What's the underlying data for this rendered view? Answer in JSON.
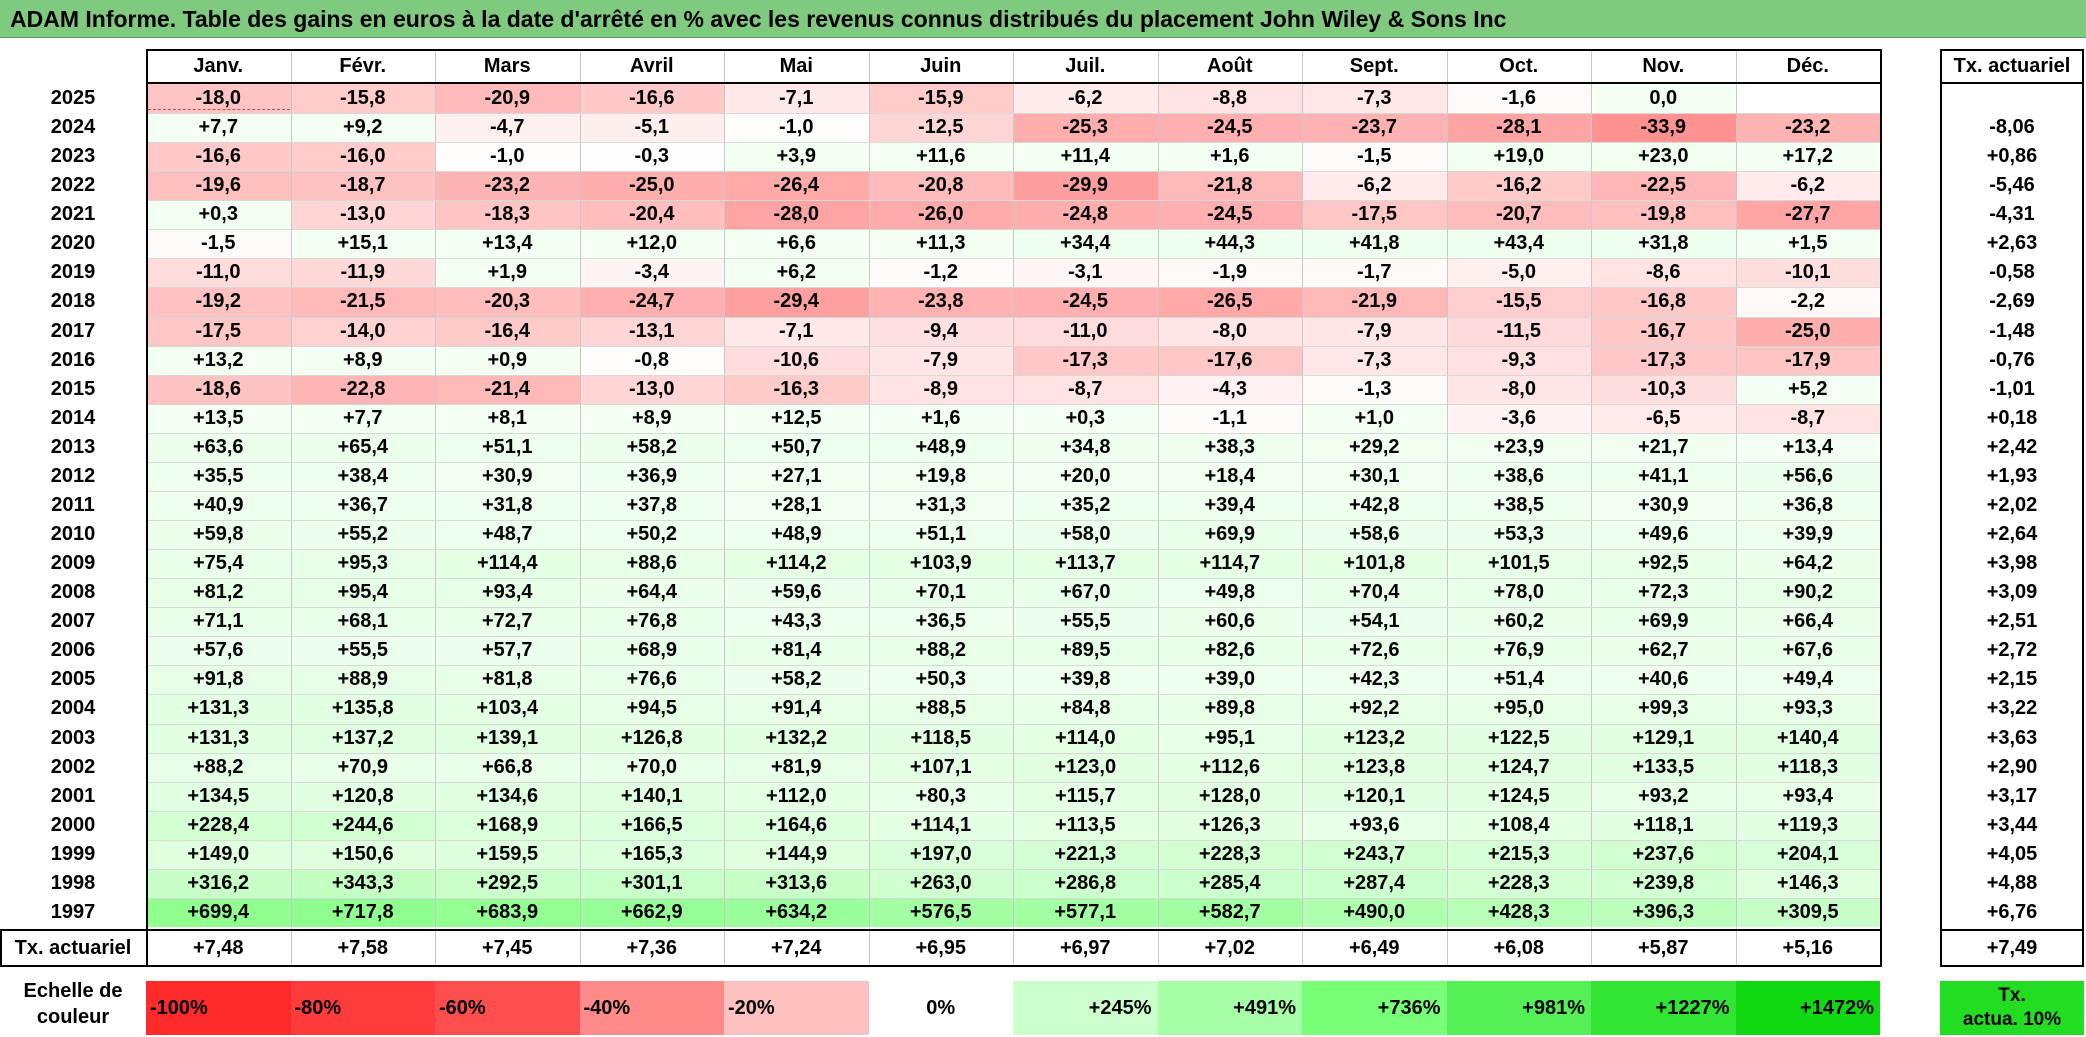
{
  "title": "ADAM Informe. Table des gains en euros à la date d'arrêté en % avec les revenus connus distribués du placement John Wiley & Sons Inc",
  "chart_data": {
    "type": "heatmap",
    "title": "ADAM Informe. Table des gains en euros à la date d'arrêté en % avec les revenus connus distribués du placement John Wiley & Sons Inc",
    "columns": [
      "Janv.",
      "Févr.",
      "Mars",
      "Avril",
      "Mai",
      "Juin",
      "Juil.",
      "Août",
      "Sept.",
      "Oct.",
      "Nov.",
      "Déc."
    ],
    "rate_header": "Tx. actuariel",
    "footer_label": "Tx. actuariel",
    "rows": [
      {
        "year": "2025",
        "values": [
          "-18,0",
          "-15,8",
          "-20,9",
          "-16,6",
          "-7,1",
          "-15,9",
          "-6,2",
          "-8,8",
          "-7,3",
          "-1,6",
          "0,0",
          ""
        ],
        "rate": ""
      },
      {
        "year": "2024",
        "values": [
          "+7,7",
          "+9,2",
          "-4,7",
          "-5,1",
          "-1,0",
          "-12,5",
          "-25,3",
          "-24,5",
          "-23,7",
          "-28,1",
          "-33,9",
          "-23,2"
        ],
        "rate": "-8,06"
      },
      {
        "year": "2023",
        "values": [
          "-16,6",
          "-16,0",
          "-1,0",
          "-0,3",
          "+3,9",
          "+11,6",
          "+11,4",
          "+1,6",
          "-1,5",
          "+19,0",
          "+23,0",
          "+17,2"
        ],
        "rate": "+0,86"
      },
      {
        "year": "2022",
        "values": [
          "-19,6",
          "-18,7",
          "-23,2",
          "-25,0",
          "-26,4",
          "-20,8",
          "-29,9",
          "-21,8",
          "-6,2",
          "-16,2",
          "-22,5",
          "-6,2"
        ],
        "rate": "-5,46"
      },
      {
        "year": "2021",
        "values": [
          "+0,3",
          "-13,0",
          "-18,3",
          "-20,4",
          "-28,0",
          "-26,0",
          "-24,8",
          "-24,5",
          "-17,5",
          "-20,7",
          "-19,8",
          "-27,7"
        ],
        "rate": "-4,31"
      },
      {
        "year": "2020",
        "values": [
          "-1,5",
          "+15,1",
          "+13,4",
          "+12,0",
          "+6,6",
          "+11,3",
          "+34,4",
          "+44,3",
          "+41,8",
          "+43,4",
          "+31,8",
          "+1,5"
        ],
        "rate": "+2,63"
      },
      {
        "year": "2019",
        "values": [
          "-11,0",
          "-11,9",
          "+1,9",
          "-3,4",
          "+6,2",
          "-1,2",
          "-3,1",
          "-1,9",
          "-1,7",
          "-5,0",
          "-8,6",
          "-10,1"
        ],
        "rate": "-0,58"
      },
      {
        "year": "2018",
        "values": [
          "-19,2",
          "-21,5",
          "-20,3",
          "-24,7",
          "-29,4",
          "-23,8",
          "-24,5",
          "-26,5",
          "-21,9",
          "-15,5",
          "-16,8",
          "-2,2"
        ],
        "rate": "-2,69"
      },
      {
        "year": "2017",
        "values": [
          "-17,5",
          "-14,0",
          "-16,4",
          "-13,1",
          "-7,1",
          "-9,4",
          "-11,0",
          "-8,0",
          "-7,9",
          "-11,5",
          "-16,7",
          "-25,0"
        ],
        "rate": "-1,48"
      },
      {
        "year": "2016",
        "values": [
          "+13,2",
          "+8,9",
          "+0,9",
          "-0,8",
          "-10,6",
          "-7,9",
          "-17,3",
          "-17,6",
          "-7,3",
          "-9,3",
          "-17,3",
          "-17,9"
        ],
        "rate": "-0,76"
      },
      {
        "year": "2015",
        "values": [
          "-18,6",
          "-22,8",
          "-21,4",
          "-13,0",
          "-16,3",
          "-8,9",
          "-8,7",
          "-4,3",
          "-1,3",
          "-8,0",
          "-10,3",
          "+5,2"
        ],
        "rate": "-1,01"
      },
      {
        "year": "2014",
        "values": [
          "+13,5",
          "+7,7",
          "+8,1",
          "+8,9",
          "+12,5",
          "+1,6",
          "+0,3",
          "-1,1",
          "+1,0",
          "-3,6",
          "-6,5",
          "-8,7"
        ],
        "rate": "+0,18"
      },
      {
        "year": "2013",
        "values": [
          "+63,6",
          "+65,4",
          "+51,1",
          "+58,2",
          "+50,7",
          "+48,9",
          "+34,8",
          "+38,3",
          "+29,2",
          "+23,9",
          "+21,7",
          "+13,4"
        ],
        "rate": "+2,42"
      },
      {
        "year": "2012",
        "values": [
          "+35,5",
          "+38,4",
          "+30,9",
          "+36,9",
          "+27,1",
          "+19,8",
          "+20,0",
          "+18,4",
          "+30,1",
          "+38,6",
          "+41,1",
          "+56,6"
        ],
        "rate": "+1,93"
      },
      {
        "year": "2011",
        "values": [
          "+40,9",
          "+36,7",
          "+31,8",
          "+37,8",
          "+28,1",
          "+31,3",
          "+35,2",
          "+39,4",
          "+42,8",
          "+38,5",
          "+30,9",
          "+36,8"
        ],
        "rate": "+2,02"
      },
      {
        "year": "2010",
        "values": [
          "+59,8",
          "+55,2",
          "+48,7",
          "+50,2",
          "+48,9",
          "+51,1",
          "+58,0",
          "+69,9",
          "+58,6",
          "+53,3",
          "+49,6",
          "+39,9"
        ],
        "rate": "+2,64"
      },
      {
        "year": "2009",
        "values": [
          "+75,4",
          "+95,3",
          "+114,4",
          "+88,6",
          "+114,2",
          "+103,9",
          "+113,7",
          "+114,7",
          "+101,8",
          "+101,5",
          "+92,5",
          "+64,2"
        ],
        "rate": "+3,98"
      },
      {
        "year": "2008",
        "values": [
          "+81,2",
          "+95,4",
          "+93,4",
          "+64,4",
          "+59,6",
          "+70,1",
          "+67,0",
          "+49,8",
          "+70,4",
          "+78,0",
          "+72,3",
          "+90,2"
        ],
        "rate": "+3,09"
      },
      {
        "year": "2007",
        "values": [
          "+71,1",
          "+68,1",
          "+72,7",
          "+76,8",
          "+43,3",
          "+36,5",
          "+55,5",
          "+60,6",
          "+54,1",
          "+60,2",
          "+69,9",
          "+66,4"
        ],
        "rate": "+2,51"
      },
      {
        "year": "2006",
        "values": [
          "+57,6",
          "+55,5",
          "+57,7",
          "+68,9",
          "+81,4",
          "+88,2",
          "+89,5",
          "+82,6",
          "+72,6",
          "+76,9",
          "+62,7",
          "+67,6"
        ],
        "rate": "+2,72"
      },
      {
        "year": "2005",
        "values": [
          "+91,8",
          "+88,9",
          "+81,8",
          "+76,6",
          "+58,2",
          "+50,3",
          "+39,8",
          "+39,0",
          "+42,3",
          "+51,4",
          "+40,6",
          "+49,4"
        ],
        "rate": "+2,15"
      },
      {
        "year": "2004",
        "values": [
          "+131,3",
          "+135,8",
          "+103,4",
          "+94,5",
          "+91,4",
          "+88,5",
          "+84,8",
          "+89,8",
          "+92,2",
          "+95,0",
          "+99,3",
          "+93,3"
        ],
        "rate": "+3,22"
      },
      {
        "year": "2003",
        "values": [
          "+131,3",
          "+137,2",
          "+139,1",
          "+126,8",
          "+132,2",
          "+118,5",
          "+114,0",
          "+95,1",
          "+123,2",
          "+122,5",
          "+129,1",
          "+140,4"
        ],
        "rate": "+3,63"
      },
      {
        "year": "2002",
        "values": [
          "+88,2",
          "+70,9",
          "+66,8",
          "+70,0",
          "+81,9",
          "+107,1",
          "+123,0",
          "+112,6",
          "+123,8",
          "+124,7",
          "+133,5",
          "+118,3"
        ],
        "rate": "+2,90"
      },
      {
        "year": "2001",
        "values": [
          "+134,5",
          "+120,8",
          "+134,6",
          "+140,1",
          "+112,0",
          "+80,3",
          "+115,7",
          "+128,0",
          "+120,1",
          "+124,5",
          "+93,2",
          "+93,4"
        ],
        "rate": "+3,17"
      },
      {
        "year": "2000",
        "values": [
          "+228,4",
          "+244,6",
          "+168,9",
          "+166,5",
          "+164,6",
          "+114,1",
          "+113,5",
          "+126,3",
          "+93,6",
          "+108,4",
          "+118,1",
          "+119,3"
        ],
        "rate": "+3,44"
      },
      {
        "year": "1999",
        "values": [
          "+149,0",
          "+150,6",
          "+159,5",
          "+165,3",
          "+144,9",
          "+197,0",
          "+221,3",
          "+228,3",
          "+243,7",
          "+215,3",
          "+237,6",
          "+204,1"
        ],
        "rate": "+4,05"
      },
      {
        "year": "1998",
        "values": [
          "+316,2",
          "+343,3",
          "+292,5",
          "+301,1",
          "+313,6",
          "+263,0",
          "+286,8",
          "+285,4",
          "+287,4",
          "+228,3",
          "+239,8",
          "+146,3"
        ],
        "rate": "+4,88"
      },
      {
        "year": "1997",
        "values": [
          "+699,4",
          "+717,8",
          "+683,9",
          "+662,9",
          "+634,2",
          "+576,5",
          "+577,1",
          "+582,7",
          "+490,0",
          "+428,3",
          "+396,3",
          "+309,5"
        ],
        "rate": "+6,76"
      }
    ],
    "footer_values": [
      "+7,48",
      "+7,58",
      "+7,45",
      "+7,36",
      "+7,24",
      "+6,95",
      "+6,97",
      "+7,02",
      "+6,49",
      "+6,08",
      "+5,87",
      "+5,16"
    ],
    "footer_rate": "+7,49",
    "color_scale": {
      "label_line1": "Echelle de",
      "label_line2": "couleur",
      "steps": [
        {
          "label": "-100%",
          "value": -100,
          "color": "#ff2a2a"
        },
        {
          "label": "-80%",
          "value": -80,
          "color": "#ff3b3b"
        },
        {
          "label": "-60%",
          "value": -60,
          "color": "#ff4d4d"
        },
        {
          "label": "-40%",
          "value": -40,
          "color": "#ff8a8a"
        },
        {
          "label": "-20%",
          "value": -20,
          "color": "#ffc0c0"
        },
        {
          "label": "0%",
          "value": 0,
          "color": "#ffffff"
        },
        {
          "label": "+245%",
          "value": 245,
          "color": "#ccffcc"
        },
        {
          "label": "+491%",
          "value": 491,
          "color": "#a6ffa6"
        },
        {
          "label": "+736%",
          "value": 736,
          "color": "#77ff77"
        },
        {
          "label": "+981%",
          "value": 981,
          "color": "#55f055"
        },
        {
          "label": "+1227%",
          "value": 1227,
          "color": "#33e533"
        },
        {
          "label": "+1472%",
          "value": 1472,
          "color": "#11d911"
        }
      ],
      "rate_swatch_line1": "Tx.",
      "rate_swatch_line2": "actua. 10%",
      "rate_swatch_color": "#22dd22"
    }
  }
}
